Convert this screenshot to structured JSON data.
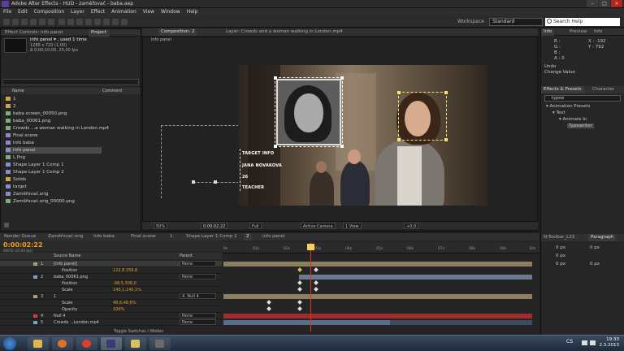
{
  "window": {
    "title": "Adobe After Effects - HUD - zaměřovač - baba.aep"
  },
  "menu": [
    "File",
    "Edit",
    "Composition",
    "Layer",
    "Effect",
    "Animation",
    "View",
    "Window",
    "Help"
  ],
  "workspace": {
    "label": "Workspace",
    "value": "Standard"
  },
  "search": {
    "placeholder": "Search Help"
  },
  "project": {
    "tabs": [
      "Effect Controls: info panel",
      "Project"
    ],
    "selected_name": "info panel ▾ , used 1 time",
    "selected_info1": "1280 x 720 (1,00)",
    "selected_info2": "Δ 0;00;10;00, 25,00 fps",
    "col_name": "Name",
    "col_comment": "Comment",
    "items": [
      {
        "name": "1",
        "type": "folder"
      },
      {
        "name": "2",
        "type": "folder"
      },
      {
        "name": "baba screen_00050.png",
        "type": "img"
      },
      {
        "name": "baba_00061.png",
        "type": "img"
      },
      {
        "name": "Crowds ...a woman walking in London.mp4",
        "type": "img"
      },
      {
        "name": "Final scene",
        "type": "comp"
      },
      {
        "name": "Info baba",
        "type": "comp"
      },
      {
        "name": "info panel",
        "type": "comp"
      },
      {
        "name": "L.Png",
        "type": "img"
      },
      {
        "name": "Shape Layer 1 Comp 1",
        "type": "comp"
      },
      {
        "name": "Shape Layer 1 Comp 2",
        "type": "comp"
      },
      {
        "name": "Solids",
        "type": "folder"
      },
      {
        "name": "target",
        "type": "comp"
      },
      {
        "name": "Zaměřovač.orig",
        "type": "comp"
      },
      {
        "name": "Zaměřovač.orig_00000.png",
        "type": "img"
      }
    ]
  },
  "comp": {
    "tabs": [
      "Composition: 2",
      "Layer: Crowds and a woman walking in London.mp4"
    ],
    "breadcrumb": "info panel",
    "info_text": [
      "TARGET INFO",
      "JANA NOVAKOVA",
      "26",
      "TEACHER"
    ],
    "zoom": "50%",
    "timecode": "0:00:02:22",
    "quality": "Full",
    "camera": "Active Camera",
    "view": "1 View",
    "exposure": "+0,0"
  },
  "timeline": {
    "tabs": [
      "Render Queue",
      "Zaměřovač.orig",
      "Info baba",
      "Final scene",
      "1",
      "Shape Layer 1 Comp 2",
      "2",
      "info panel"
    ],
    "timecode": "0:00:02:22",
    "timecode_sub": "00072 (25.00 fps)",
    "col_source": "Source Name",
    "col_parent": "Parent",
    "ruler": [
      "0s",
      "01s",
      "02s",
      "03s",
      "04s",
      "05s",
      "06s",
      "07s",
      "08s",
      "09s",
      "10s"
    ],
    "layers": [
      {
        "num": "1",
        "name": "[info panel]",
        "value": "",
        "parent": "None",
        "color": "#b0a070"
      },
      {
        "num": "",
        "name": "Position",
        "value": "122,8,358,8",
        "parent": "",
        "color": ""
      },
      {
        "num": "2",
        "name": "baba_00061.png",
        "value": "",
        "parent": "None",
        "color": "#7f9fcf"
      },
      {
        "num": "",
        "name": "Position",
        "value": "-98,5,308,0",
        "parent": "",
        "color": ""
      },
      {
        "num": "",
        "name": "Scale",
        "value": "140,1,140,1%",
        "parent": "",
        "color": ""
      },
      {
        "num": "3",
        "name": "1",
        "value": "",
        "parent": "4. Null 4",
        "color": "#b0a070"
      },
      {
        "num": "",
        "name": "Scale",
        "value": "48,6,48,6%",
        "parent": "",
        "color": ""
      },
      {
        "num": "",
        "name": "Opacity",
        "value": "100%",
        "parent": "",
        "color": ""
      },
      {
        "num": "4",
        "name": "Null 4",
        "value": "",
        "parent": "None",
        "color": "#cf4040"
      },
      {
        "num": "5",
        "name": "Crowds ...London.mp4",
        "value": "",
        "parent": "None",
        "color": "#7f9fcf"
      }
    ],
    "toggle_label": "Toggle Switches / Modes"
  },
  "info_panel": {
    "tabs": [
      "Info",
      "Preview",
      "Info"
    ],
    "r": "R :",
    "g": "G :",
    "b": "B :",
    "a": "A : 0",
    "x": "X : -192",
    "y": "Y : 792",
    "undo": "Undo",
    "change": "Change Value"
  },
  "effects_panel": {
    "tabs": [
      "Effects & Presets",
      "Character"
    ],
    "search": "typew",
    "tree": [
      "▾ Animation Presets",
      "▾ Text",
      "▾ Animate In",
      "Typewriter"
    ]
  },
  "paragraph_panel": {
    "tabs": [
      "N-Toolbar_L33",
      "Paragraph"
    ],
    "fields": [
      "0 px",
      "0 px",
      "0 px",
      "0 px",
      "0 px"
    ]
  },
  "taskbar": {
    "lang": "CS",
    "time": "19:33",
    "date": "2.3.2013"
  }
}
